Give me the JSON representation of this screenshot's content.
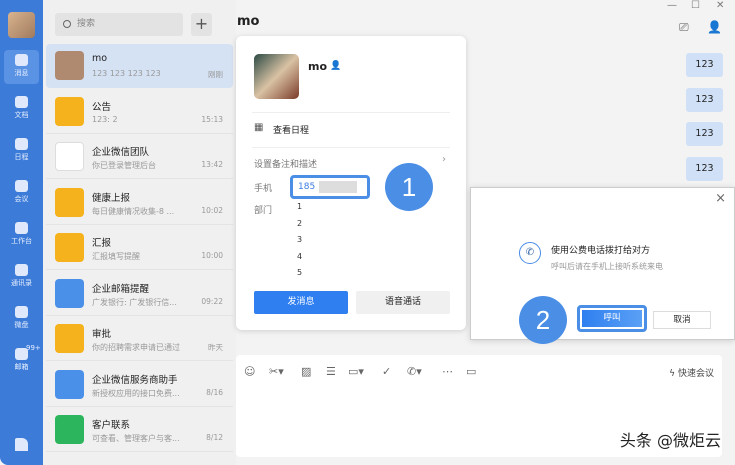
{
  "sidebar": {
    "items": [
      {
        "label": "消息"
      },
      {
        "label": "文档"
      },
      {
        "label": "日程"
      },
      {
        "label": "会议"
      },
      {
        "label": "工作台"
      },
      {
        "label": "通讯录"
      },
      {
        "label": "微盘"
      },
      {
        "label": "邮箱",
        "badge": "99+"
      }
    ]
  },
  "search": {
    "placeholder": "搜索",
    "add": "+"
  },
  "conversations": [
    {
      "name": "mo",
      "preview": "123 123 123 123",
      "time": "刚刚",
      "color": "#b08a70"
    },
    {
      "name": "公告",
      "preview": "123: 2",
      "time": "15:13",
      "color": "#f5b21c"
    },
    {
      "name": "企业微信团队",
      "preview": "你已登录管理后台",
      "time": "13:42",
      "color": "#ffffff"
    },
    {
      "name": "健康上报",
      "preview": "每日健康情况收集-8 ...",
      "time": "10:02",
      "color": "#f5b21c"
    },
    {
      "name": "汇报",
      "preview": "汇报填写提醒",
      "time": "10:00",
      "color": "#f5b21c"
    },
    {
      "name": "企业邮箱提醒",
      "preview": "广发银行: 广发银行信...",
      "time": "09:22",
      "color": "#4a90e8"
    },
    {
      "name": "审批",
      "preview": "你的招聘需求申请已通过",
      "time": "昨天",
      "color": "#f5b21c"
    },
    {
      "name": "企业微信服务商助手",
      "preview": "新授权应用的接口免费...",
      "time": "8/16",
      "color": "#4a90e8"
    },
    {
      "name": "客户联系",
      "preview": "可查看、管理客户与客...",
      "time": "8/12",
      "color": "#2db55d"
    }
  ],
  "chat": {
    "title": "mo",
    "messages": [
      "123",
      "123",
      "123",
      "123"
    ],
    "quick_meeting": "快速会议",
    "toolbar": [
      "emoji",
      "scissors",
      "image",
      "document",
      "folder",
      "check",
      "phone",
      "more",
      "screen"
    ]
  },
  "profile": {
    "name": "mo",
    "schedule": "查看日程",
    "remark": "设置备注和描述",
    "phone_label": "手机",
    "phone": "185",
    "dept_label": "部门",
    "depts": [
      "1",
      "2",
      "3",
      "4",
      "5"
    ],
    "send": "发消息",
    "voice": "语音通话"
  },
  "dialog": {
    "title": "使用公费电话拨打给对方",
    "subtitle": "呼叫后请在手机上接听系统来电",
    "call": "呼叫",
    "cancel": "取消",
    "close": "×"
  },
  "steps": [
    "1",
    "2"
  ],
  "watermark": "头条 @微炬云"
}
